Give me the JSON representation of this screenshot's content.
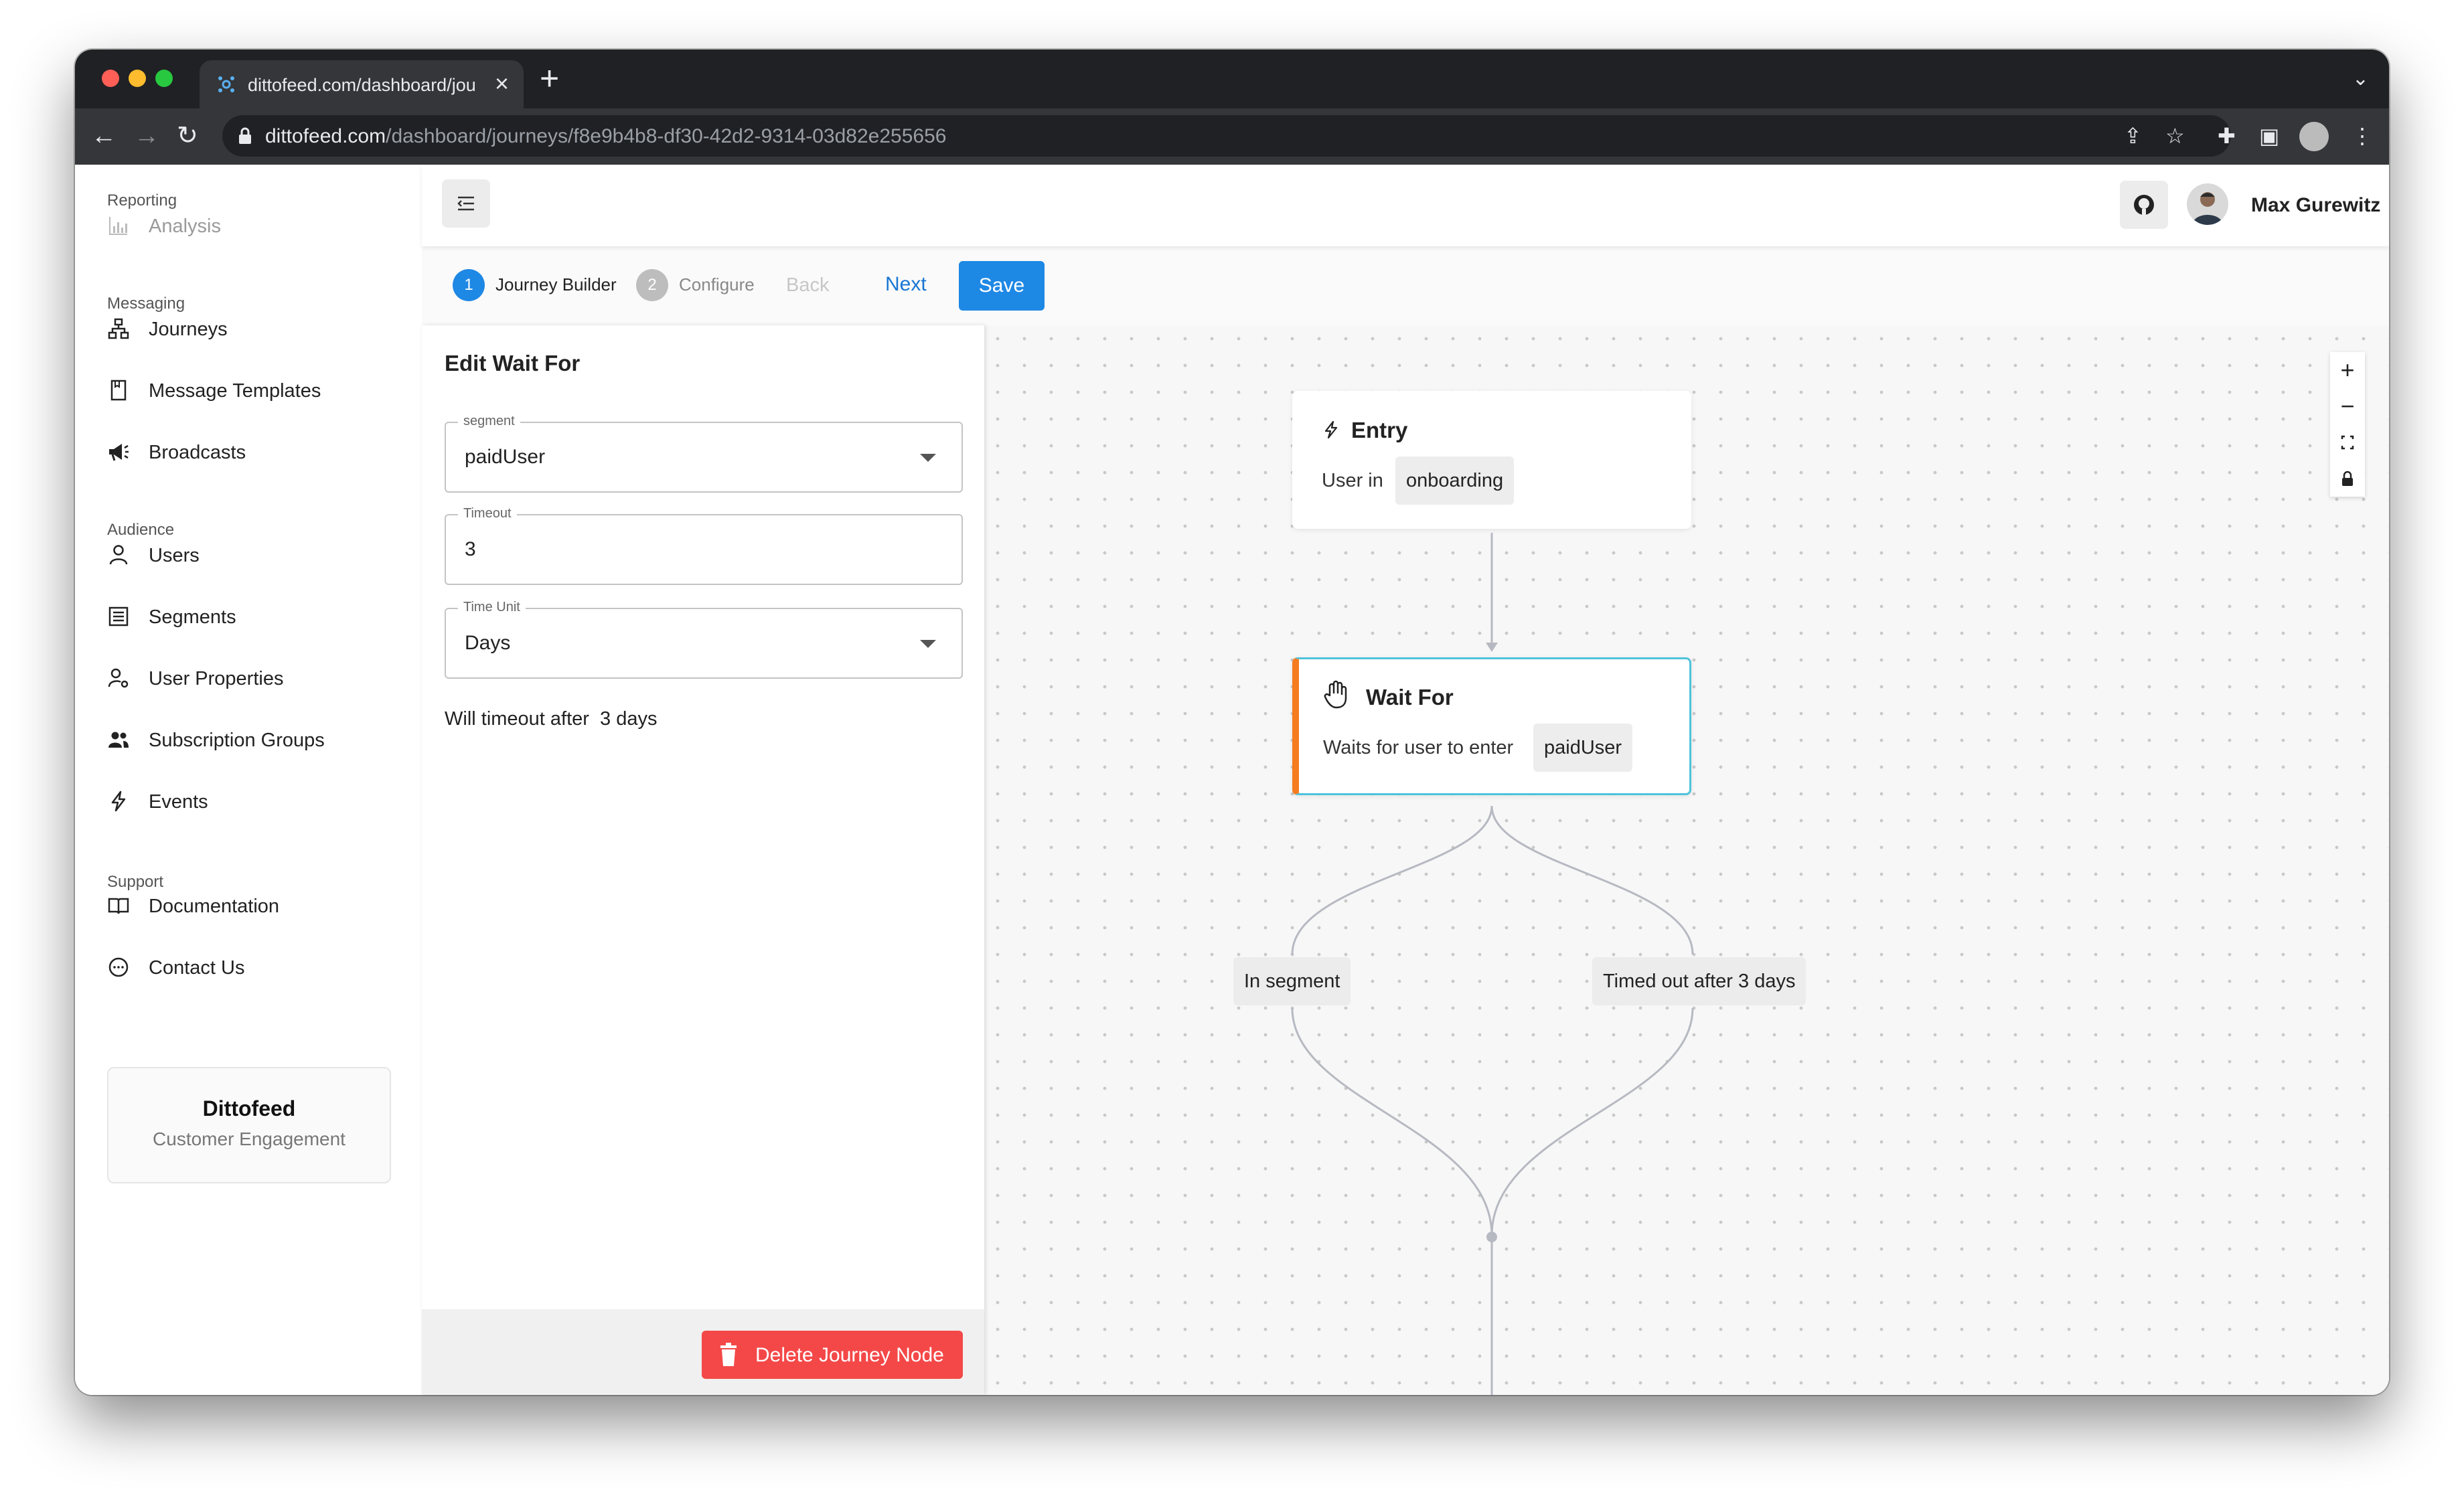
{
  "browser": {
    "tab_title": "dittofeed.com/dashboard/journ",
    "url_host": "dittofeed.com",
    "url_path": "/dashboard/journeys/f8e9b4b8-df30-42d2-9314-03d82e255656"
  },
  "sidebar": {
    "sections": {
      "reporting": "Reporting",
      "messaging": "Messaging",
      "audience": "Audience",
      "support": "Support"
    },
    "items": {
      "analysis": "Analysis",
      "journeys": "Journeys",
      "message_templates": "Message Templates",
      "broadcasts": "Broadcasts",
      "users": "Users",
      "segments": "Segments",
      "user_properties": "User Properties",
      "subscription_groups": "Subscription Groups",
      "events": "Events",
      "documentation": "Documentation",
      "contact_us": "Contact Us"
    },
    "brand": {
      "name": "Dittofeed",
      "tagline": "Customer Engagement"
    }
  },
  "header": {
    "user_name": "Max Gurewitz"
  },
  "stepper": {
    "step1_num": "1",
    "step1_label": "Journey Builder",
    "step2_num": "2",
    "step2_label": "Configure",
    "back": "Back",
    "next": "Next",
    "save": "Save"
  },
  "editor": {
    "title": "Edit Wait For",
    "segment_label": "segment",
    "segment_value": "paidUser",
    "timeout_label": "Timeout",
    "timeout_value": "3",
    "time_unit_label": "Time Unit",
    "time_unit_value": "Days",
    "timeout_note": "Will timeout after  3 days",
    "delete_label": "Delete Journey Node"
  },
  "canvas": {
    "entry": {
      "title": "Entry",
      "text": "User in",
      "chip": "onboarding"
    },
    "wait_for": {
      "title": "Wait For",
      "text": "Waits for user to enter",
      "chip": "paidUser"
    },
    "branch_left": "In segment",
    "branch_right": "Timed out after 3 days",
    "controls": {
      "zoom_in": "+",
      "zoom_out": "−"
    }
  },
  "colors": {
    "accent": "#1e88e5",
    "danger": "#f44848",
    "wait_node_border": "#4fc3dc",
    "wait_node_stripe": "#f57c20"
  }
}
